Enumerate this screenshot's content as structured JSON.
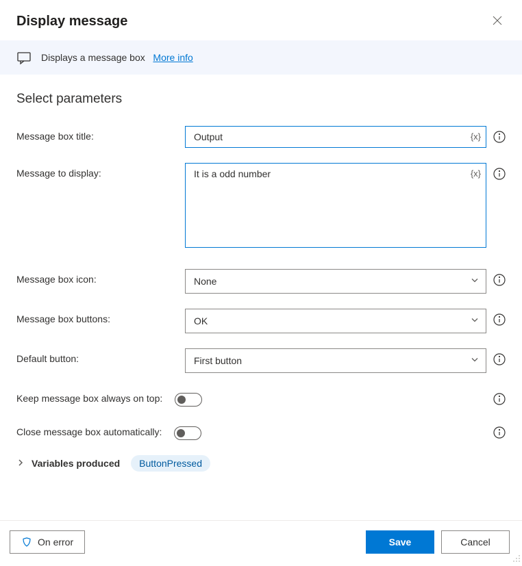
{
  "header": {
    "title": "Display message"
  },
  "banner": {
    "text": "Displays a message box",
    "more_info": "More info"
  },
  "section_title": "Select parameters",
  "fields": {
    "title": {
      "label": "Message box title:",
      "value": "Output"
    },
    "message": {
      "label": "Message to display:",
      "value": "It is a odd number"
    },
    "icon": {
      "label": "Message box icon:",
      "value": "None"
    },
    "buttons": {
      "label": "Message box buttons:",
      "value": "OK"
    },
    "default_button": {
      "label": "Default button:",
      "value": "First button"
    },
    "always_on_top": {
      "label": "Keep message box always on top:"
    },
    "auto_close": {
      "label": "Close message box automatically:"
    }
  },
  "variables": {
    "label": "Variables produced",
    "chip": "ButtonPressed"
  },
  "footer": {
    "on_error": "On error",
    "save": "Save",
    "cancel": "Cancel"
  }
}
